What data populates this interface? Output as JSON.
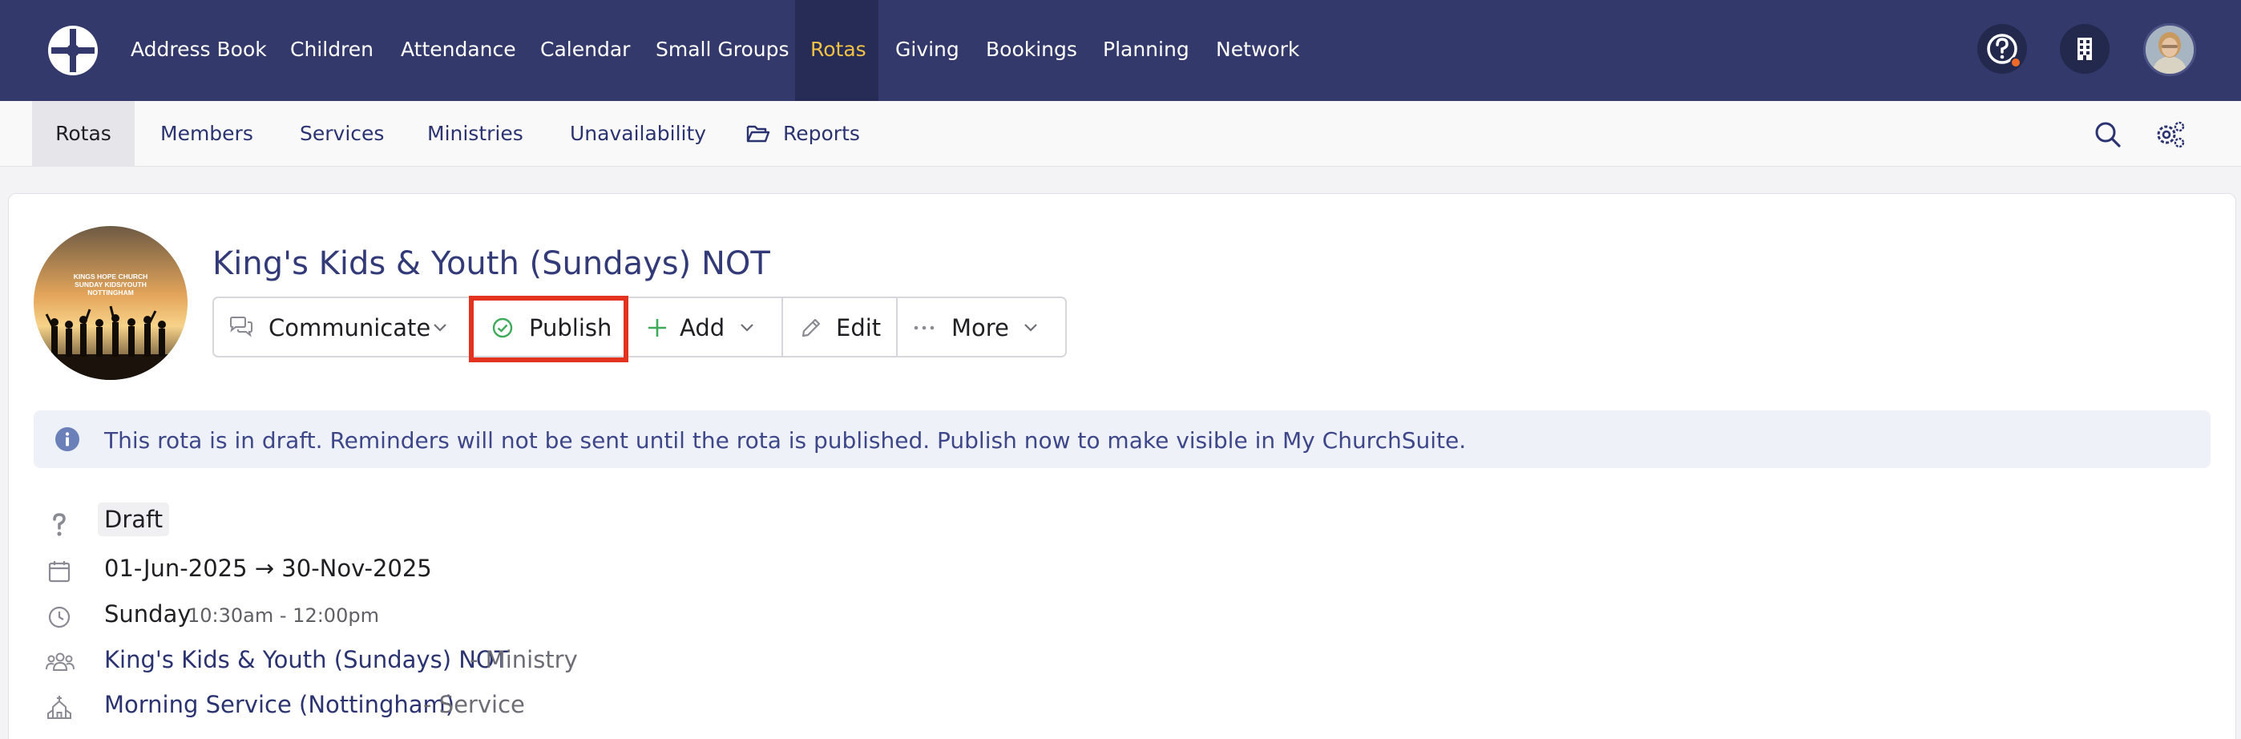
{
  "top_nav": {
    "items": [
      "Address Book",
      "Children",
      "Attendance",
      "Calendar",
      "Small Groups",
      "Rotas",
      "Giving",
      "Bookings",
      "Planning",
      "Network"
    ],
    "active": "Rotas",
    "icons": [
      "help-icon",
      "building-icon",
      "user-avatar"
    ],
    "accent_color": "#f5c144",
    "bg_color": "#333a6b"
  },
  "sub_nav": {
    "items": [
      "Rotas",
      "Members",
      "Services",
      "Ministries",
      "Unavailability",
      "Reports"
    ],
    "active": "Rotas",
    "icons": [
      "search-icon",
      "settings-icon",
      "folder-icon"
    ]
  },
  "rota": {
    "image_text": [
      "KINGS HOPE CHURCH",
      "SUNDAY KIDS/YOUTH",
      "NOTTINGHAM"
    ],
    "title": "King's Kids & Youth (Sundays) NOT",
    "actions": {
      "communicate": "Communicate",
      "publish": "Publish",
      "add": "Add",
      "edit": "Edit",
      "more": "More"
    },
    "banner": "This rota is in draft. Reminders will not be sent until the rota is published. Publish now to make visible in My ChurchSuite.",
    "status": "Draft",
    "dates": "01-Jun-2025 → 30-Nov-2025",
    "day": "Sunday",
    "time": "10:30am - 12:00pm",
    "ministry_name": "King's Kids & Youth (Sundays) NOT",
    "ministry_suffix": "- Ministry",
    "service_name": "Morning Service (Nottingham)",
    "service_suffix": "- Service"
  },
  "highlight_color": "#e3321e"
}
